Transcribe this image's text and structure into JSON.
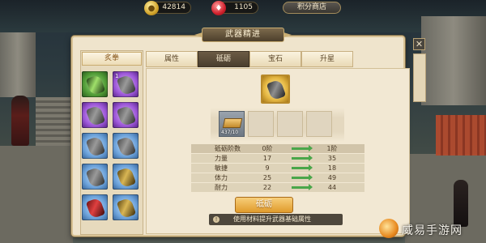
{
  "currency": {
    "gold_value": "42814",
    "gem_value": "1105",
    "shop_label": "积分商店"
  },
  "panel": {
    "title": "武器精进"
  },
  "weapon_list": {
    "category": "炙拳",
    "items": [
      {
        "rarity": "green",
        "badge": ""
      },
      {
        "rarity": "purple",
        "badge": "1"
      },
      {
        "rarity": "purple",
        "badge": ""
      },
      {
        "rarity": "purple",
        "badge": ""
      },
      {
        "rarity": "blue",
        "badge": ""
      },
      {
        "rarity": "blue",
        "badge": ""
      },
      {
        "rarity": "blue",
        "badge": ""
      },
      {
        "rarity": "blue",
        "badge": ""
      },
      {
        "rarity": "blue",
        "badge": ""
      },
      {
        "rarity": "blue",
        "badge": ""
      }
    ]
  },
  "tabs": [
    {
      "label": "属性",
      "active": false
    },
    {
      "label": "砥砺",
      "active": true
    },
    {
      "label": "宝石",
      "active": false
    },
    {
      "label": "升星",
      "active": false
    }
  ],
  "material": {
    "qty": "437/10"
  },
  "stats": {
    "header": {
      "label": "砥砺阶数",
      "current": "0阶",
      "next": "1阶"
    },
    "rows": [
      {
        "label": "力量",
        "current": "17",
        "next": "35"
      },
      {
        "label": "敏捷",
        "current": "9",
        "next": "18"
      },
      {
        "label": "体力",
        "current": "25",
        "next": "49"
      },
      {
        "label": "耐力",
        "current": "22",
        "next": "44"
      }
    ]
  },
  "refine_button": "砥砺",
  "hint_text": "使用材料提升武器基础属性",
  "watermark": "威易手游网",
  "colors": {
    "accent_orange": "#e09b2c",
    "active_tab": "#4a3e2e",
    "increase_arrow": "#4aa64a"
  }
}
